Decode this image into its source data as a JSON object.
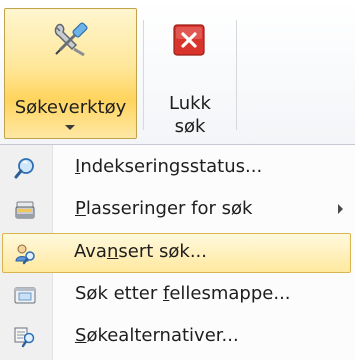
{
  "ribbon": {
    "search_tools": {
      "label": "Søkeverktøy",
      "icon": "tools-icon"
    },
    "close_search": {
      "label_line1": "Lukk",
      "label_line2": "søk",
      "icon": "close-icon"
    }
  },
  "menu": {
    "items": [
      {
        "pre": "",
        "ul": "I",
        "post": "ndekseringsstatus...",
        "icon": "index-status-icon",
        "submenu": false,
        "highlighted": false
      },
      {
        "pre": "",
        "ul": "P",
        "post": "lasseringer for søk",
        "icon": "locations-icon",
        "submenu": true,
        "highlighted": false
      },
      {
        "pre": "Ava",
        "ul": "n",
        "post": "sert søk...",
        "icon": "advanced-search-icon",
        "submenu": false,
        "highlighted": true
      },
      {
        "pre": "Søk etter ",
        "ul": "f",
        "post": "ellesmappe...",
        "icon": "public-folder-icon",
        "submenu": false,
        "highlighted": false
      },
      {
        "pre": "",
        "ul": "S",
        "post": "økealternativer...",
        "icon": "search-options-icon",
        "submenu": false,
        "highlighted": false
      }
    ]
  },
  "colors": {
    "highlight_border": "#d8b54e",
    "close_red": "#d9342b"
  }
}
